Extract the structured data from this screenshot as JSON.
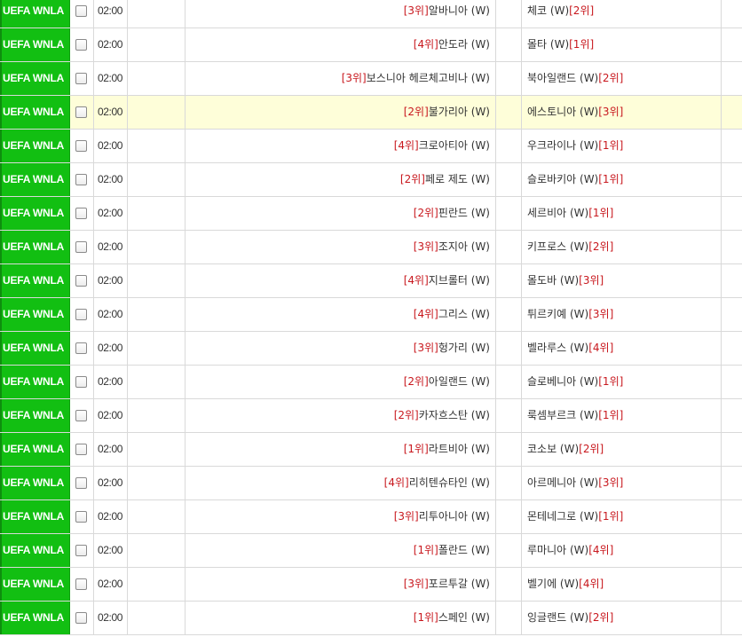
{
  "colors": {
    "league_bg": "#12bf12",
    "rank_text": "#c8181e",
    "highlight_row": "#fefed9"
  },
  "matches": [
    {
      "league": "UEFA WNLA",
      "time": "02:00",
      "home_rank": "[3위]",
      "home": "알바니아 (W)",
      "away": "체코 (W)",
      "away_rank": "[2위]"
    },
    {
      "league": "UEFA WNLA",
      "time": "02:00",
      "home_rank": "[4위]",
      "home": "안도라 (W)",
      "away": "몰타 (W)",
      "away_rank": "[1위]"
    },
    {
      "league": "UEFA WNLA",
      "time": "02:00",
      "home_rank": "[3위]",
      "home": "보스니아 헤르체고비나 (W)",
      "away": "북아일랜드 (W)",
      "away_rank": "[2위]"
    },
    {
      "league": "UEFA WNLA",
      "time": "02:00",
      "home_rank": "[2위]",
      "home": "불가리아 (W)",
      "away": "에스토니아 (W)",
      "away_rank": "[3위]"
    },
    {
      "league": "UEFA WNLA",
      "time": "02:00",
      "home_rank": "[4위]",
      "home": "크로아티아 (W)",
      "away": "우크라이나 (W)",
      "away_rank": "[1위]"
    },
    {
      "league": "UEFA WNLA",
      "time": "02:00",
      "home_rank": "[2위]",
      "home": "페로 제도 (W)",
      "away": "슬로바키아 (W)",
      "away_rank": "[1위]"
    },
    {
      "league": "UEFA WNLA",
      "time": "02:00",
      "home_rank": "[2위]",
      "home": "핀란드 (W)",
      "away": "세르비아 (W)",
      "away_rank": "[1위]"
    },
    {
      "league": "UEFA WNLA",
      "time": "02:00",
      "home_rank": "[3위]",
      "home": "조지아 (W)",
      "away": "키프로스 (W)",
      "away_rank": "[2위]"
    },
    {
      "league": "UEFA WNLA",
      "time": "02:00",
      "home_rank": "[4위]",
      "home": "지브롤터 (W)",
      "away": "몰도바 (W)",
      "away_rank": "[3위]"
    },
    {
      "league": "UEFA WNLA",
      "time": "02:00",
      "home_rank": "[4위]",
      "home": "그리스 (W)",
      "away": "튀르키예 (W)",
      "away_rank": "[3위]"
    },
    {
      "league": "UEFA WNLA",
      "time": "02:00",
      "home_rank": "[3위]",
      "home": "헝가리 (W)",
      "away": "벨라루스 (W)",
      "away_rank": "[4위]"
    },
    {
      "league": "UEFA WNLA",
      "time": "02:00",
      "home_rank": "[2위]",
      "home": "아일랜드 (W)",
      "away": "슬로베니아 (W)",
      "away_rank": "[1위]"
    },
    {
      "league": "UEFA WNLA",
      "time": "02:00",
      "home_rank": "[2위]",
      "home": "카자흐스탄 (W)",
      "away": "룩셈부르크 (W)",
      "away_rank": "[1위]"
    },
    {
      "league": "UEFA WNLA",
      "time": "02:00",
      "home_rank": "[1위]",
      "home": "라트비아 (W)",
      "away": "코소보 (W)",
      "away_rank": "[2위]"
    },
    {
      "league": "UEFA WNLA",
      "time": "02:00",
      "home_rank": "[4위]",
      "home": "리히텐슈타인 (W)",
      "away": "아르메니아 (W)",
      "away_rank": "[3위]"
    },
    {
      "league": "UEFA WNLA",
      "time": "02:00",
      "home_rank": "[3위]",
      "home": "리투아니아 (W)",
      "away": "몬테네그로 (W)",
      "away_rank": "[1위]"
    },
    {
      "league": "UEFA WNLA",
      "time": "02:00",
      "home_rank": "[1위]",
      "home": "폴란드 (W)",
      "away": "루마니아 (W)",
      "away_rank": "[4위]"
    },
    {
      "league": "UEFA WNLA",
      "time": "02:00",
      "home_rank": "[3위]",
      "home": "포르투갈 (W)",
      "away": "벨기에 (W)",
      "away_rank": "[4위]"
    },
    {
      "league": "UEFA WNLA",
      "time": "02:00",
      "home_rank": "[1위]",
      "home": "스페인 (W)",
      "away": "잉글랜드 (W)",
      "away_rank": "[2위]"
    }
  ]
}
